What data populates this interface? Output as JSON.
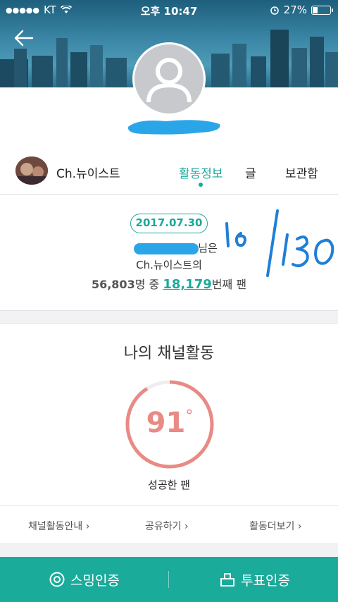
{
  "status_bar": {
    "carrier": "KT",
    "time": "오후 10:47",
    "battery_percent": "27%",
    "battery_level": 0.27
  },
  "channel": {
    "name": "Ch.뉴이스트"
  },
  "tabs": [
    {
      "label": "활동정보",
      "active": true
    },
    {
      "label": "글",
      "active": false
    },
    {
      "label": "보관함",
      "active": false
    }
  ],
  "fan_info": {
    "date": "2017.07.30",
    "line1_suffix": "님은",
    "line2": "Ch.뉴이스트의",
    "total_fans": "56,803",
    "total_suffix": "명 중",
    "rank": "18,179",
    "rank_suffix": "번째 팬"
  },
  "handwriting": "16/130",
  "activity": {
    "title": "나의 채널활동",
    "score": "91",
    "score_unit": "°",
    "score_level": 0.91,
    "level_label": "성공한 팬",
    "links": [
      "채널활동안내",
      "공유하기",
      "활동더보기"
    ]
  },
  "bottom_bar": {
    "left_label": "스밍인증",
    "right_label": "투표인증"
  },
  "colors": {
    "accent": "#1aa99a",
    "gauge": "#e98a84",
    "redaction": "#2aa6e8"
  }
}
